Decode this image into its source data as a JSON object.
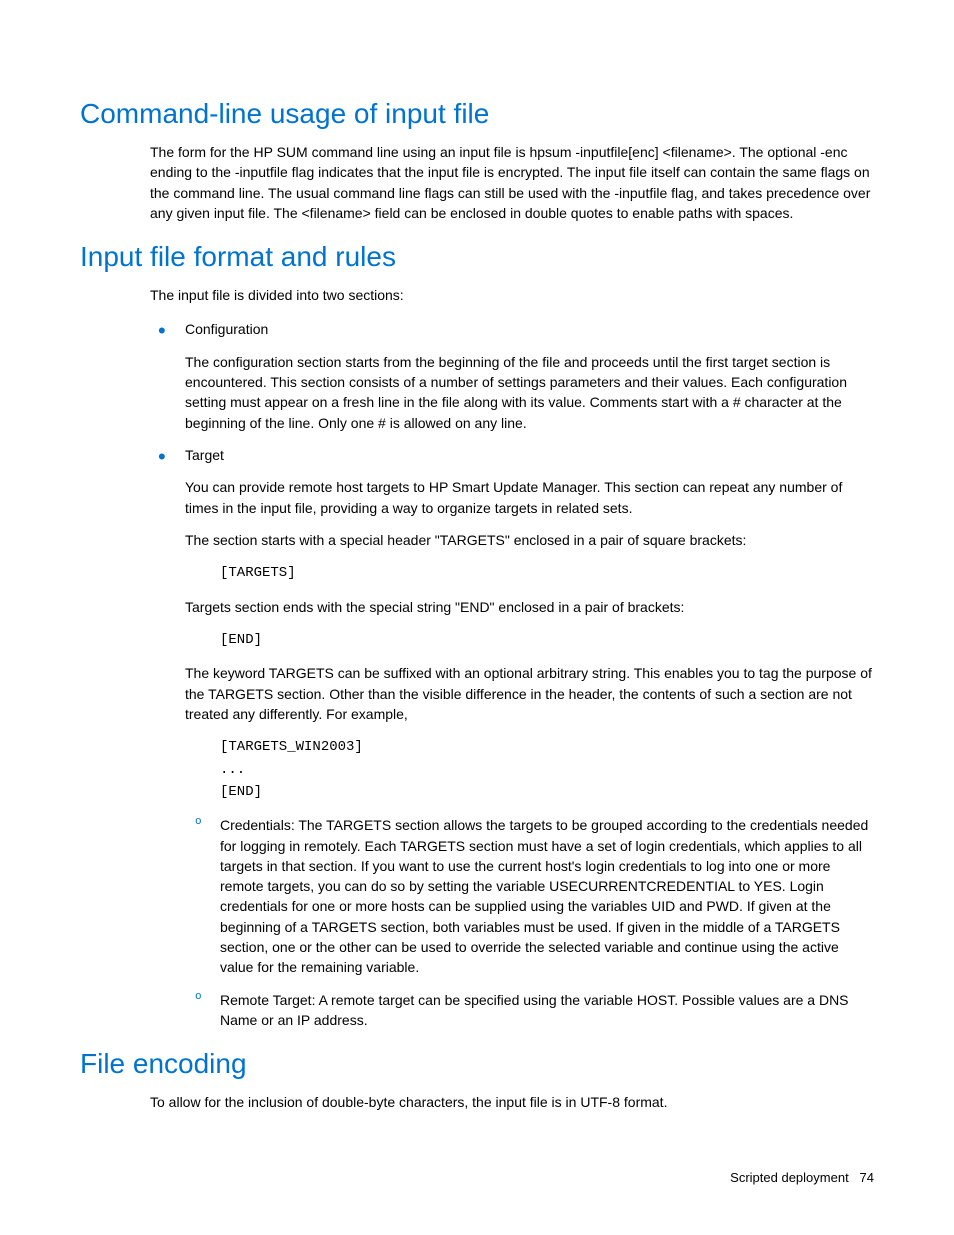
{
  "section1": {
    "heading": "Command-line usage of input file",
    "para1": "The form for the HP SUM command line using an input file is hpsum -inputfile[enc] <filename>. The optional -enc ending to the -inputfile flag indicates that the input file is encrypted. The input file itself can contain the same flags on the command line. The usual command line flags can still be used with the -inputfile flag, and takes precedence over any given input file. The <filename> field can be enclosed in double quotes to enable paths with spaces."
  },
  "section2": {
    "heading": "Input file format and rules",
    "intro": "The input file is divided into two sections:",
    "items": [
      {
        "label": "Configuration",
        "desc": "The configuration section starts from the beginning of the file and proceeds until the first target section is encountered. This section consists of a number of settings parameters and their values. Each configuration setting must appear on a fresh line in the file along with its value. Comments start with a # character at the beginning of the line. Only one # is allowed on any line."
      },
      {
        "label": "Target",
        "desc": "You can provide remote host targets to HP Smart Update Manager. This section can repeat any number of times in the input file, providing a way to organize targets in related sets.",
        "p2": "The section starts with a special header \"TARGETS\" enclosed in a pair of square brackets:",
        "code1": "[TARGETS]",
        "p3": "Targets section ends with the special string \"END\" enclosed in a pair of brackets:",
        "code2": "[END]",
        "p4": "The keyword TARGETS can be suffixed with an optional arbitrary string. This enables you to tag the purpose of the TARGETS section. Other than the visible difference in the header, the contents of such a section are not treated any differently. For example,",
        "code3": "[TARGETS_WIN2003]\n...\n[END]",
        "sub": [
          "Credentials: The TARGETS section allows the targets to be grouped according to the credentials needed for logging in remotely. Each TARGETS section must have a set of login credentials, which applies to all targets in that section. If you want to use the current host's login credentials to log into one or more remote targets, you can do so by setting the variable USECURRENTCREDENTIAL to YES. Login credentials for one or more hosts can be supplied using the variables UID and PWD. If given at the beginning of a TARGETS section, both variables must be used. If given in the middle of a TARGETS section, one or the other can be used to override the selected variable and continue using the active value for the remaining variable.",
          "Remote Target: A remote target can be specified using the variable HOST. Possible values are a DNS Name or an IP address."
        ]
      }
    ]
  },
  "section3": {
    "heading": "File encoding",
    "para1": "To allow for the inclusion of double-byte characters, the input file is in UTF-8 format."
  },
  "footer": {
    "label": "Scripted deployment",
    "page": "74"
  }
}
